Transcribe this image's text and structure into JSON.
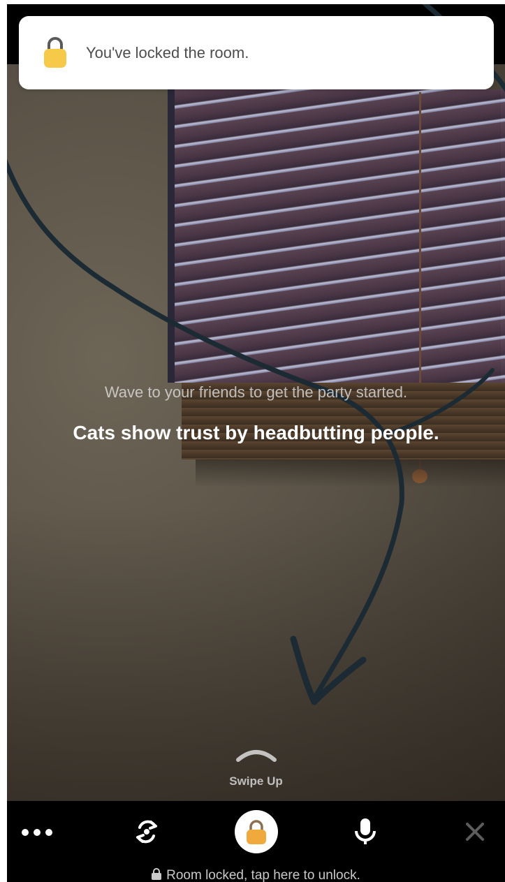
{
  "banner": {
    "message": "You've locked the room.",
    "icon": "padlock-icon",
    "icon_color": "#F7C948"
  },
  "room": {
    "hint": "Wave to your friends to get the party started.",
    "fact": "Cats show trust by headbutting people."
  },
  "swipe": {
    "label": "Swipe Up",
    "icon": "chevron-up-icon"
  },
  "toolbar": {
    "buttons": [
      {
        "name": "more",
        "icon": "more-dots-icon"
      },
      {
        "name": "flip-camera",
        "icon": "camera-flip-icon"
      },
      {
        "name": "lock",
        "icon": "padlock-icon",
        "color": "#F0A93C"
      },
      {
        "name": "microphone",
        "icon": "microphone-icon"
      },
      {
        "name": "close",
        "icon": "close-icon"
      }
    ],
    "lock_status": "Room locked, tap here to unlock."
  },
  "colors": {
    "toolbar_bg": "#000000",
    "banner_bg": "#FFFFFF",
    "lock_accent": "#F0A93C"
  }
}
